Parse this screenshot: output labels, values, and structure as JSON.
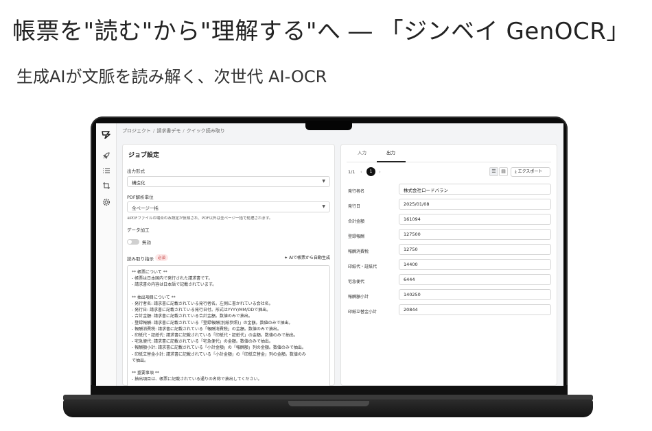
{
  "hero": {
    "headline": "帳票を\"読む\"から\"理解する\"へ ― 「ジンベイ GenOCR」",
    "subline": "生成AIが文脈を読み解く、次世代 AI-OCR"
  },
  "app": {
    "breadcrumb": [
      "プロジェクト",
      "請求書デモ",
      "クイック読み取り"
    ],
    "sidebar_icons": [
      "logo-icon",
      "rocket-icon",
      "list-icon",
      "crop-icon",
      "gear-icon"
    ],
    "job": {
      "title": "ジョブ設定",
      "output_format_label": "出力形式",
      "output_format_value": "構造化",
      "pdf_unit_label": "PDF解析単位",
      "pdf_unit_value": "全ページ一括",
      "pdf_note": "※PDFファイルの場合のみ設定が反映され、PDF以外は全ページ一括で処理されます。",
      "data_processing_label": "データ加工",
      "toggle_label": "無効",
      "instructions_label": "読み取り指示",
      "required_badge": "必須",
      "ai_generate_label": "AIで帳票から自動生成",
      "instructions_lines": [
        "** 帳票について **",
        "- 帳票は日本国内で発行された請求書です。",
        "- 請求書の内容は日本語で記載されています。",
        "",
        "** 抽出項目について **",
        "- 発行者名: 請求書に記載されている発行者名。左側に書かれている会社名。",
        "- 発行日: 請求書に記載されている発行日付。形式はYYYY/MM/DDで抽出。",
        "- 合計金額: 請求書に記載されている合計金額。数値のみで抽出。",
        "- 登録報酬: 請求書に記載されている「登録報酬(別紙参照)」の金額。数値のみで抽出。",
        "- 報酬消費税: 請求書に記載されている「報酬消費税」の金額。数値のみで抽出。",
        "- 印紙代・証紙代: 請求書に記載されている「印紙代・証紙代」の金額。数値のみで抽出。",
        "- 宅急便代: 請求書に記載されている「宅急便代」の金額。数値のみで抽出。",
        "- 報酬額小計: 請求書に記載されている「小計金額」の「報酬額」列の金額。数値のみで抽出。",
        "- 印紙立替金小計: 請求書に記載されている「小計金額」の「印紙立替金」列の金額。数値のみ",
        "で抽出。",
        "",
        "** 重要事項 **",
        "- 抽出項目は、帳票に記載されている通りの名称で抽出してください。"
      ]
    },
    "result": {
      "tabs": [
        "入力",
        "出力"
      ],
      "active_tab": "出力",
      "pager_text": "1/1",
      "current_page": "1",
      "export_label": "エクスポート",
      "fields": [
        {
          "label": "発行者名",
          "value": "株式会社ロードバラン"
        },
        {
          "label": "発行日",
          "value": "2025/01/08"
        },
        {
          "label": "合計金額",
          "value": "161094"
        },
        {
          "label": "登録報酬",
          "value": "127500"
        },
        {
          "label": "報酬消費税",
          "value": "12750"
        },
        {
          "label": "印紙代・証紙代",
          "value": "14400"
        },
        {
          "label": "宅急便代",
          "value": "6444"
        },
        {
          "label": "報酬額小計",
          "value": "140250"
        },
        {
          "label": "印紙立替金小計",
          "value": "20844"
        }
      ]
    }
  }
}
